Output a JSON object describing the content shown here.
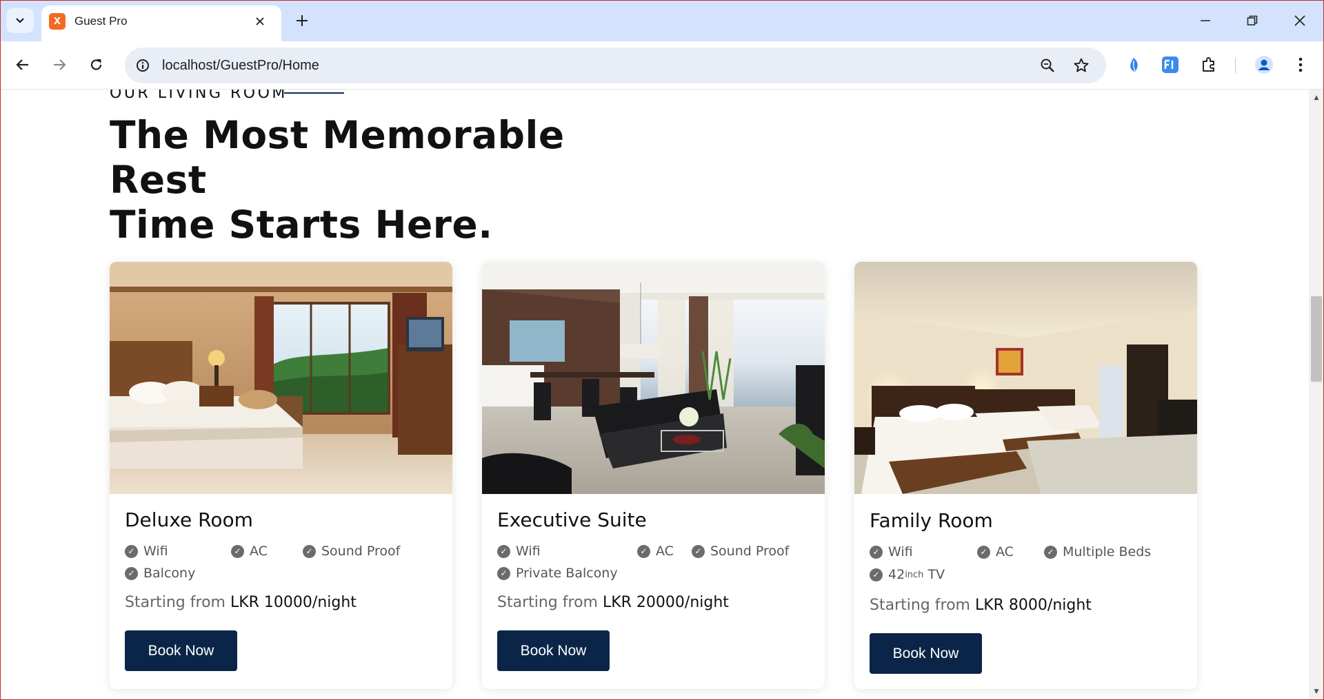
{
  "browser": {
    "tab_title": "Guest Pro",
    "favicon_text": "X",
    "url": "localhost/GuestPro/Home"
  },
  "section": {
    "eyebrow": "OUR LIVING ROOM",
    "headline_line1": "The Most Memorable Rest",
    "headline_line2": "Time Starts Here."
  },
  "rooms": [
    {
      "name": "Deluxe Room",
      "amenities": [
        "Wifi",
        "AC",
        "Sound Proof",
        "Balcony"
      ],
      "price_label": "Starting from",
      "price": "LKR 10000/night",
      "button": "Book Now"
    },
    {
      "name": "Executive Suite",
      "amenities": [
        "Wifi",
        "AC",
        "Sound Proof",
        "Private Balcony"
      ],
      "price_label": "Starting from",
      "price": "LKR 20000/night",
      "button": "Book Now"
    },
    {
      "name": "Family Room",
      "amenities": [
        "Wifi",
        "AC",
        "Multiple Beds",
        "42",
        "inch",
        "TV"
      ],
      "price_label": "Starting from",
      "price": "LKR 8000/night",
      "button": "Book Now"
    }
  ],
  "colors": {
    "accent": "#0b2548",
    "eyebrow_line": "#0b2a5b",
    "tab_strip": "#d3e3fd",
    "omnibox": "#e9eef6"
  },
  "icons": [
    "tab-search-icon",
    "favicon-icon",
    "close-icon",
    "plus-icon",
    "minimize-icon",
    "restore-icon",
    "back-icon",
    "forward-icon",
    "reload-icon",
    "site-info-icon",
    "zoom-icon",
    "star-icon",
    "extension-leaf-icon",
    "extension-fi-icon",
    "extensions-puzzle-icon",
    "profile-icon",
    "more-icon",
    "check-icon"
  ]
}
